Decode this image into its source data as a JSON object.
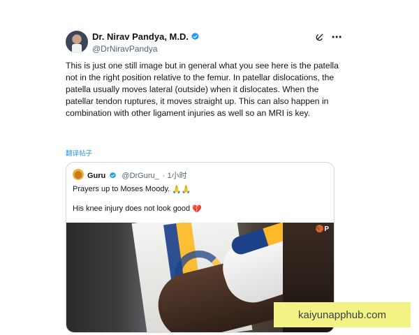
{
  "author": {
    "name": "Dr. Nirav Pandya, M.D.",
    "handle": "@DrNiravPandya",
    "verified_icon": "verified-badge-icon"
  },
  "actions": {
    "grok_icon": "grok-icon",
    "more_icon": "more-icon",
    "more_label": "⋯"
  },
  "tweet": {
    "text": "This is just one still image but in general what you see here is the patella not in the right position relative to the femur. In patellar dislocations, the patella usually moves lateral (outside) when it dislocates.  When the patellar tendon ruptures, it moves straight up.  This can also happen in combination with other ligament injuries as well so an MRI is key.",
    "translate_label": "翻译帖子"
  },
  "quote": {
    "name": "Guru",
    "handle": "@DrGuru_",
    "separator": "·",
    "time": "1小时",
    "line1": "Prayers up to Moses Moody.",
    "line1_emoji": "🙏🙏",
    "line2": "His knee injury does not look good",
    "line2_emoji": "💔",
    "media_badge": "🏀P"
  },
  "watermark": {
    "text": "kaiyunapphub.com"
  },
  "colors": {
    "link": "#1d9bf0",
    "verified": "#1d9bf0",
    "secondary_text": "#536471",
    "watermark_bg": "#f3f285",
    "warriors_blue": "#1d428a",
    "warriors_gold": "#fdb927"
  }
}
